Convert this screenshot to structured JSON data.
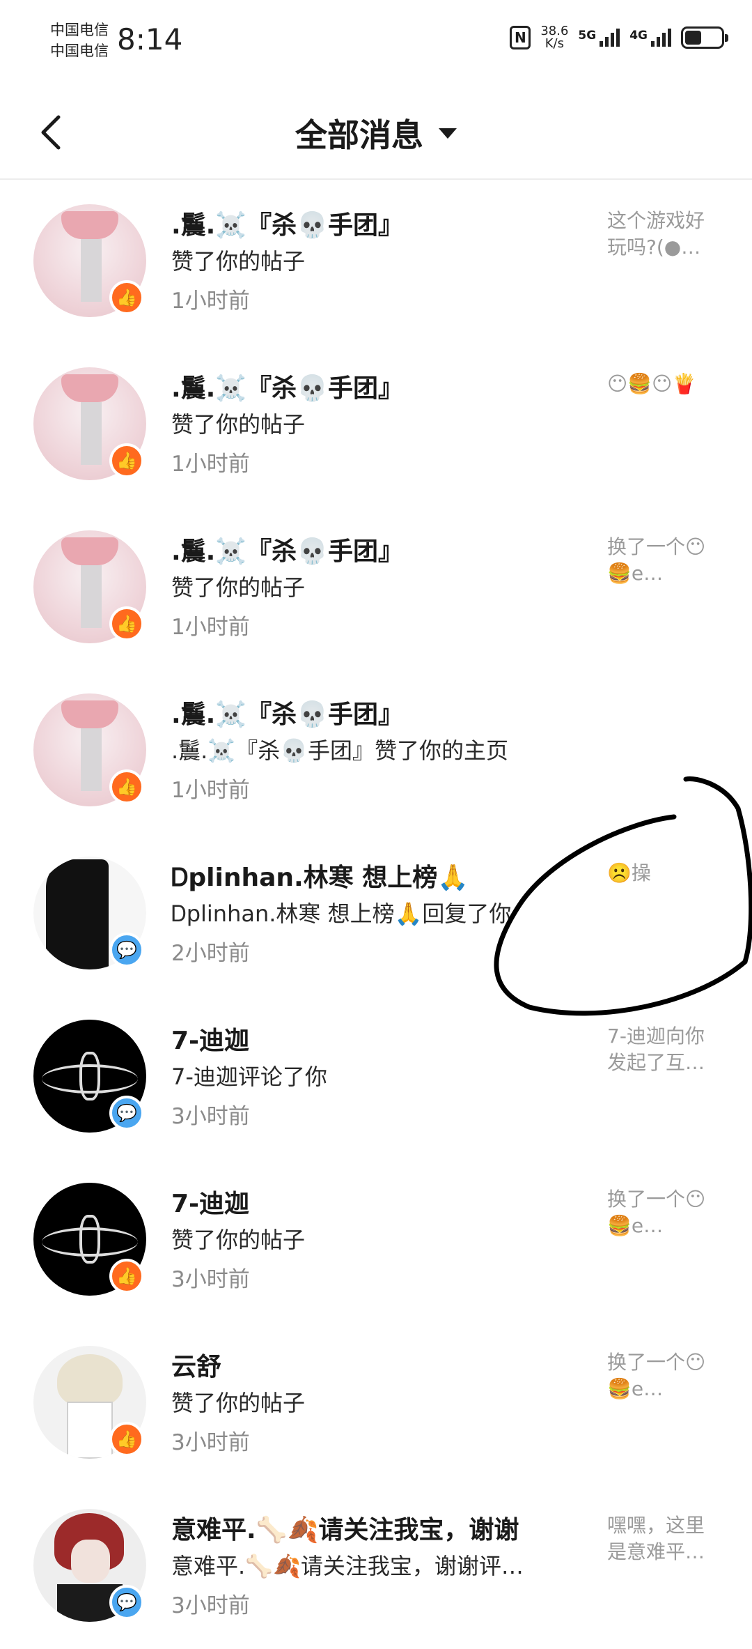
{
  "status_bar": {
    "carrier_1": "中国电信",
    "carrier_2": "中国电信",
    "time": "8:14",
    "nfc": "N",
    "net_speed_value": "38.6",
    "net_speed_unit": "K/s",
    "net_5g": "5G",
    "net_4g": "4G",
    "battery_level": 0.45
  },
  "header": {
    "title": "全部消息"
  },
  "messages": [
    {
      "name": ".鬞.☠️『杀💀手团』",
      "action": "赞了你的帖子",
      "time": "1小时前",
      "preview": "这个游戏好玩吗?(●…",
      "badge": "like",
      "badge_icon": "👍",
      "avatar": "pink"
    },
    {
      "name": ".鬞.☠️『杀💀手团』",
      "action": "赞了你的帖子",
      "time": "1小时前",
      "preview": "😶🍔😶🍟",
      "badge": "like",
      "badge_icon": "👍",
      "avatar": "pink"
    },
    {
      "name": ".鬞.☠️『杀💀手团』",
      "action": "赞了你的帖子",
      "time": "1小时前",
      "preview": "换了一个😶 🍔e…",
      "badge": "like",
      "badge_icon": "👍",
      "avatar": "pink"
    },
    {
      "name": ".鬞.☠️『杀💀手团』",
      "action": ".鬞.☠️『杀💀手团』赞了你的主页",
      "time": "1小时前",
      "preview": "",
      "badge": "like",
      "badge_icon": "👍",
      "avatar": "pink"
    },
    {
      "name": "Ꭰplinhan.林寒 想上榜🙏",
      "action": "Ꭰplinhan.林寒 想上榜🙏回复了你",
      "time": "2小时前",
      "preview": "☹️操",
      "badge": "reply",
      "badge_icon": "💬",
      "avatar": "white"
    },
    {
      "name": "7-迪迦",
      "action": "7-迪迦评论了你",
      "time": "3小时前",
      "preview": "7-迪迦向你发起了互…",
      "badge": "reply",
      "badge_icon": "💬",
      "avatar": "black"
    },
    {
      "name": "7-迪迦",
      "action": "赞了你的帖子",
      "time": "3小时前",
      "preview": "换了一个😶 🍔e…",
      "badge": "like",
      "badge_icon": "👍",
      "avatar": "black"
    },
    {
      "name": "云舒",
      "action": "赞了你的帖子",
      "time": "3小时前",
      "preview": "换了一个😶 🍔e…",
      "badge": "like",
      "badge_icon": "👍",
      "avatar": "anime"
    },
    {
      "name": "意难平.🦴🍂请关注我宝，谢谢",
      "action": "意难平.🦴🍂请关注我宝，谢谢评…",
      "time": "3小时前",
      "preview": "嘿嘿，这里是意难平…",
      "badge": "reply",
      "badge_icon": "💬",
      "avatar": "red"
    }
  ],
  "colors": {
    "like_badge": "#ff6a1e",
    "reply_badge": "#4aa6f0",
    "scribble": "#000000"
  },
  "icons": {
    "back": "chevron-left-icon",
    "title_dropdown": "caret-down-icon",
    "like_badge": "thumbs-up-icon",
    "reply_badge": "chat-bubble-icon"
  }
}
